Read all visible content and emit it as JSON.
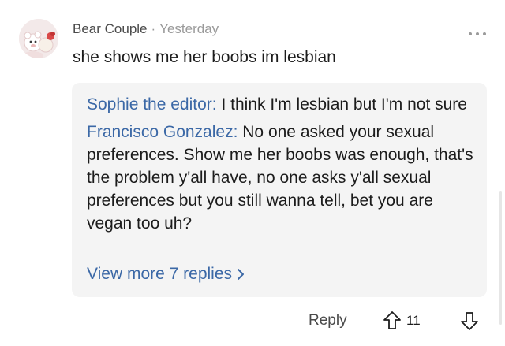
{
  "comment": {
    "author": "Bear Couple",
    "separator": "·",
    "time": "Yesterday",
    "text": "she shows me her boobs im lesbian",
    "avatar_icon": "bear-couple-avatar",
    "more_icon": "more-horizontal-icon"
  },
  "replies": {
    "items": [
      {
        "author": "Sophie the editor:",
        "text": "I think I'm lesbian but I'm not sure"
      },
      {
        "author": "Francisco Gonzalez:",
        "text": "No one asked your sexual preferences. Show me her boobs was enough, that's the problem y'all have, no one asks y'all sexual preferences but you still wanna tell, bet you are vegan too uh?"
      }
    ],
    "view_more_label": "View more 7 replies"
  },
  "actions": {
    "reply_label": "Reply",
    "upvote_count": "11",
    "upvote_icon": "arrow-up-icon",
    "downvote_icon": "arrow-down-icon"
  },
  "colors": {
    "link_blue": "#3b68a6",
    "reply_box_bg": "#f4f4f4",
    "meta_gray": "#9a9a9a"
  }
}
